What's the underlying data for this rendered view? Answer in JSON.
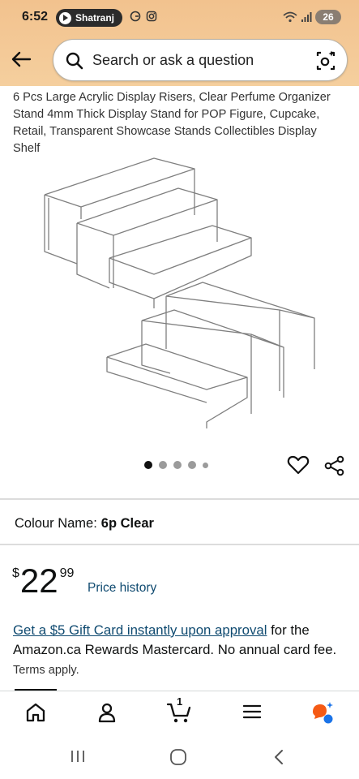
{
  "status_bar": {
    "time": "6:52",
    "app_pill_label": "Shatranj",
    "battery_level": "26"
  },
  "search": {
    "placeholder": "Search or ask a question"
  },
  "product": {
    "title": "6 Pcs Large Acrylic Display Risers, Clear Perfume Organizer Stand 4mm Thick Display Stand for POP Figure, Cupcake, Retail, Transparent Showcase Stands Collectibles Display Shelf",
    "image_pagination": {
      "total": 5,
      "active_index": 0
    },
    "colour_label": "Colour Name:",
    "colour_value": "6p Clear",
    "price": {
      "currency": "$",
      "whole": "22",
      "fraction": "99"
    },
    "price_history_label": "Price history",
    "promo": {
      "link_text": "Get a $5 Gift Card instantly upon approval",
      "body_text": " for the Amazon.ca Rewards Mastercard. No annual card fee. ",
      "terms_text": "Terms apply."
    }
  },
  "bottom_nav": {
    "items": [
      "home-icon",
      "account-icon",
      "cart-icon",
      "menu-icon",
      "rufus-icon"
    ],
    "cart_count": "1"
  },
  "system_nav": [
    "recents-icon",
    "home-circle-icon",
    "back-chevron-icon"
  ],
  "colors": {
    "header_bg": "#f2c28e",
    "link": "#0f4a70",
    "rufus_orange": "#f55a14",
    "rufus_blue": "#1a73e8"
  }
}
